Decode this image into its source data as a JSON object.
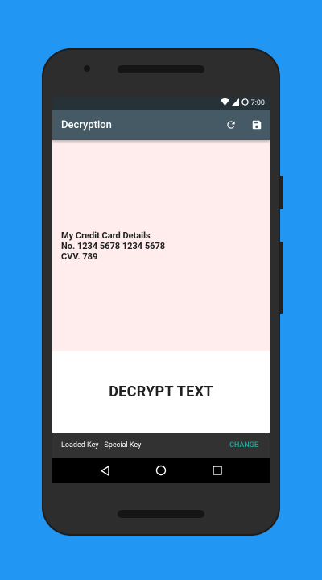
{
  "statusbar": {
    "time": "7:00",
    "icons": [
      "wifi-icon",
      "signal-icon",
      "battery-icon"
    ]
  },
  "appbar": {
    "title": "Decryption",
    "actions": [
      "refresh-icon",
      "save-icon"
    ],
    "color": "#455A64"
  },
  "content": {
    "text": "My Credit Card Details\nNo. 1234 5678 1234 5678\nCVV. 789",
    "background": "#FFEDED"
  },
  "decrypt_button": {
    "label": "DECRYPT TEXT"
  },
  "snackbar": {
    "message": "Loaded Key - Special Key",
    "action": "CHANGE",
    "action_color": "#26A69A"
  },
  "navbar": {
    "buttons": [
      "back-icon",
      "home-icon",
      "recents-icon"
    ]
  },
  "colors": {
    "background": "#2196F3",
    "device": "#2d2d2d"
  }
}
